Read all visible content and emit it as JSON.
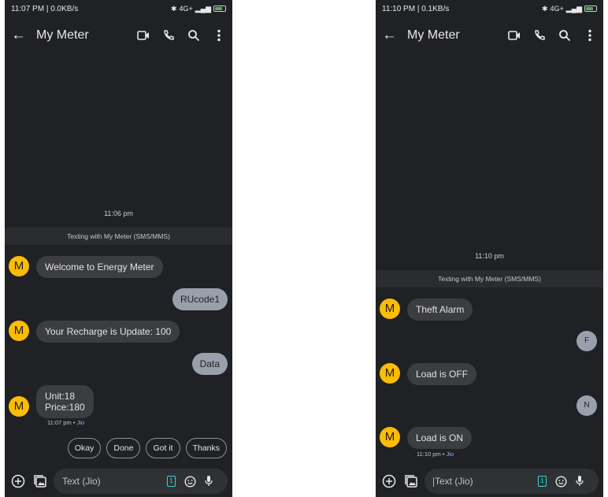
{
  "screens": [
    {
      "status": {
        "time": "11:07 PM | 0.0KB/s",
        "signal": "4G+"
      },
      "app_bar": {
        "back_glyph": "←",
        "title": "My Meter"
      },
      "timestamp": "11:06 pm",
      "banner": "Texting with My Meter (SMS/MMS)",
      "messages": {
        "m1": {
          "avatar": "M",
          "text": "Welcome to Energy Meter"
        },
        "m2": {
          "text": "RUcode1"
        },
        "m3": {
          "avatar": "M",
          "text": "Your Recharge is Update: 100"
        },
        "m4": {
          "text": "Data"
        },
        "m5": {
          "avatar": "M",
          "text": "Unit:18\nPrice:180",
          "time": "11:07 pm",
          "carrier": "Jio"
        }
      },
      "quick_replies": [
        "Okay",
        "Done",
        "Got it",
        "Thanks"
      ],
      "composer": {
        "placeholder": "Text (Jio)",
        "sim": "1"
      }
    },
    {
      "status": {
        "time": "11:10 PM | 0.1KB/s",
        "signal": "4G+"
      },
      "app_bar": {
        "back_glyph": "←",
        "title": "My Meter"
      },
      "timestamp": "11:10 pm",
      "banner": "Texting with My Meter (SMS/MMS)",
      "messages": {
        "m1": {
          "avatar": "M",
          "text": "Theft Alarm"
        },
        "m2": {
          "text": "F"
        },
        "m3": {
          "avatar": "M",
          "text": "Load is OFF"
        },
        "m4": {
          "text": "N"
        },
        "m5": {
          "avatar": "M",
          "text": "Load is ON",
          "time": "11:10 pm",
          "carrier": "Jio"
        }
      },
      "composer": {
        "placeholder": "Text (Jio)",
        "sim": "1"
      }
    }
  ],
  "icons": {
    "back": "arrow-left",
    "video": "video-camera",
    "call": "phone",
    "search": "magnifier",
    "more": "three-dots-vertical",
    "add": "plus-circle",
    "gallery": "image-library",
    "sim": "sim-card",
    "emoji": "smiley",
    "mic": "microphone"
  },
  "colors": {
    "background": "#202124",
    "avatar": "#fbbc04",
    "incoming_bubble": "#3c3d40",
    "outgoing_bubble": "#9aa0ab",
    "carrier": "#8ab4f8",
    "sim": "#34d4d4"
  }
}
